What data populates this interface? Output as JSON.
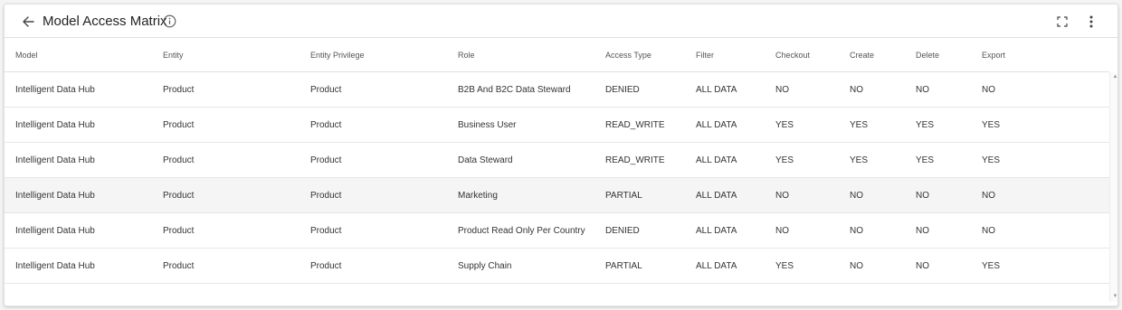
{
  "header": {
    "title": "Model Access Matrix"
  },
  "columns": [
    "Model",
    "Entity",
    "Entity Privilege",
    "Role",
    "Access Type",
    "Filter",
    "Checkout",
    "Create",
    "Delete",
    "Export"
  ],
  "rows": [
    [
      "Intelligent Data Hub",
      "Product",
      "Product",
      "B2B And B2C Data Steward",
      "DENIED",
      "ALL DATA",
      "NO",
      "NO",
      "NO",
      "NO"
    ],
    [
      "Intelligent Data Hub",
      "Product",
      "Product",
      "Business User",
      "READ_WRITE",
      "ALL DATA",
      "YES",
      "YES",
      "YES",
      "YES"
    ],
    [
      "Intelligent Data Hub",
      "Product",
      "Product",
      "Data Steward",
      "READ_WRITE",
      "ALL DATA",
      "YES",
      "YES",
      "YES",
      "YES"
    ],
    [
      "Intelligent Data Hub",
      "Product",
      "Product",
      "Marketing",
      "PARTIAL",
      "ALL DATA",
      "NO",
      "NO",
      "NO",
      "NO"
    ],
    [
      "Intelligent Data Hub",
      "Product",
      "Product",
      "Product Read Only Per Country",
      "DENIED",
      "ALL DATA",
      "NO",
      "NO",
      "NO",
      "NO"
    ],
    [
      "Intelligent Data Hub",
      "Product",
      "Product",
      "Supply Chain",
      "PARTIAL",
      "ALL DATA",
      "YES",
      "NO",
      "NO",
      "YES"
    ]
  ],
  "icons": {
    "back": "arrow-left-icon",
    "info": "info-icon",
    "fullscreen": "fullscreen-icon",
    "more": "more-vert-icon"
  },
  "colors": {
    "row_highlight": "#f5f5f5",
    "border": "#e0e0e0",
    "text": "#333333"
  }
}
